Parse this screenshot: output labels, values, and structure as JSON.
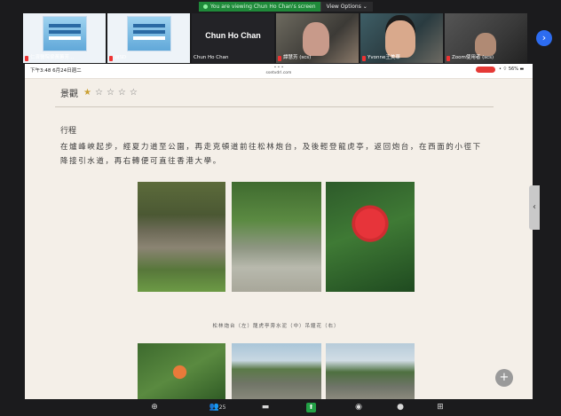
{
  "banner": {
    "message": "You are viewing Chun Ho Chan's screen",
    "options_label": "View Options ⌄"
  },
  "participants": [
    {
      "name": "仁濟醫院梁黃蕙芳...",
      "type": "poster"
    },
    {
      "name": "WSD",
      "type": "poster"
    },
    {
      "name": "Chun Ho Chan",
      "display": "Chun Ho Chan",
      "type": "dark"
    },
    {
      "name": "譚慧芳 (scs)",
      "type": "cam1"
    },
    {
      "name": "Yvonne王美華",
      "type": "cam2"
    },
    {
      "name": "Zoom使用者 (scs)",
      "type": "cam3"
    }
  ],
  "shared_screen": {
    "status_time": "下午3:48  6月24日週二",
    "url_line1": "• • •",
    "url_line2": "ssetvdrl.com",
    "battery": "• ⌔ 56% ▬",
    "rating_label": "景觀",
    "rating_value": 1,
    "rating_max": 5,
    "section_title": "行程",
    "paragraph": "在爐峰峽起步，經夏力道至公園，再走克頓道前往松林炮台，及後輕登龍虎亭，返回炮台，在西面的小徑下降接引水道，再右轉便可直往香港大學。",
    "caption": "松林炮台（左）龍虎亭旁水泥（中）吊鐘花（右）"
  },
  "toolbar": {
    "audio_icon": "⊕",
    "participants_count": "25",
    "chat_icon": "▬",
    "share_icon": "⬆",
    "record_icon": "◉",
    "reactions_icon": "●",
    "apps_icon": "⊞"
  },
  "icons": {
    "next": "›",
    "scroll_tab": "‹",
    "plus": "+"
  }
}
